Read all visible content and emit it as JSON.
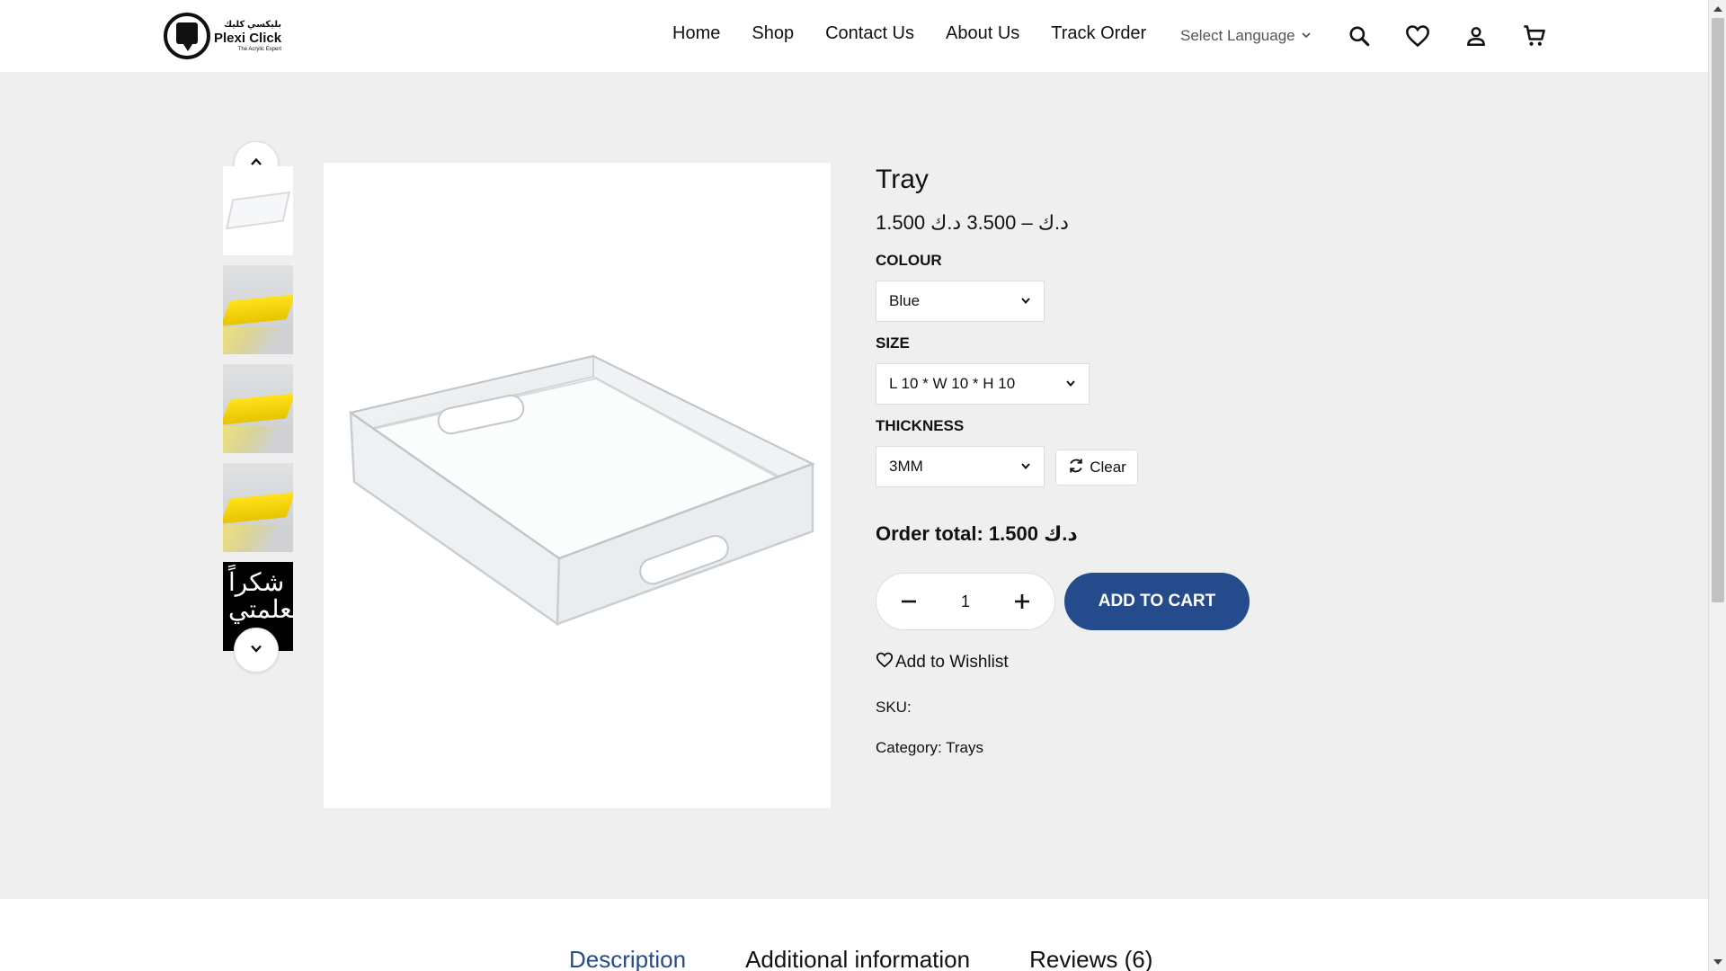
{
  "brand": {
    "name": "Plexi Click",
    "name_ar": "بليكسي كليك",
    "tagline": "The Acrylic Expert"
  },
  "nav": {
    "items": [
      {
        "label": "Home"
      },
      {
        "label": "Shop"
      },
      {
        "label": "Contact Us"
      },
      {
        "label": "About Us"
      },
      {
        "label": "Track Order"
      }
    ],
    "language_label": "Select Language"
  },
  "header_icons": [
    "search-icon",
    "heart-icon",
    "user-icon",
    "cart-icon"
  ],
  "gallery": {
    "thumbnails": [
      "clear-tray",
      "yellow-tray",
      "yellow-tray",
      "yellow-tray",
      "calligraphy"
    ],
    "calligraphy_text": "شكراً معلمتي"
  },
  "product": {
    "title": "Tray",
    "price_range": "1.500 د.ك – 3.500 د.ك",
    "options": {
      "colour": {
        "label": "COLOUR",
        "value": "Blue"
      },
      "size": {
        "label": "SIZE",
        "value": "L 10 * W 10 * H 10"
      },
      "thickness": {
        "label": "THICKNESS",
        "value": "3MM"
      }
    },
    "clear_label": "Clear",
    "order_total_label": "Order total:",
    "order_total_value": "1.500 د.ك",
    "quantity": "1",
    "add_to_cart_label": "ADD TO CART",
    "wishlist_label": "Add to Wishlist",
    "sku_label": "SKU:",
    "category_label": "Category:",
    "category_value": "Trays"
  },
  "tabs": [
    {
      "label": "Description",
      "active": true
    },
    {
      "label": "Additional information",
      "active": false
    },
    {
      "label": "Reviews (6)",
      "active": false
    }
  ],
  "colors": {
    "accent": "#254b8c",
    "page_bg": "#efeff0"
  }
}
